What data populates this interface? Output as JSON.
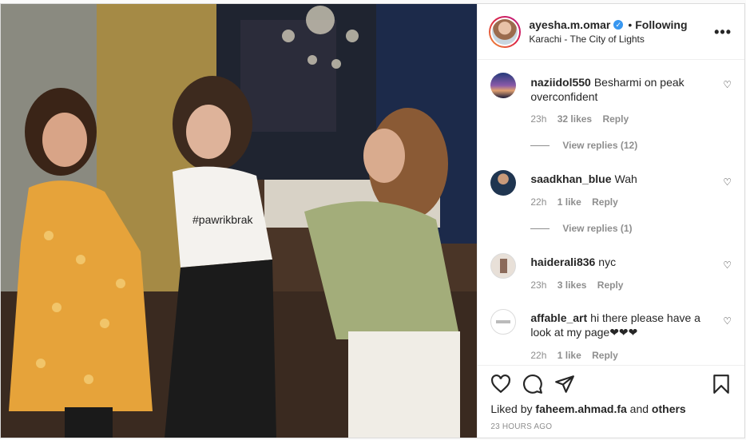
{
  "post": {
    "username": "ayesha.m.omar",
    "verified_icon": "verified-badge-icon",
    "separator": "•",
    "follow_status": "Following",
    "location": "Karachi - The City of Lights",
    "more_icon": "more-options-icon",
    "more_glyph": "•••",
    "video_overlay_text": "#pawrikbrak"
  },
  "comments": [
    {
      "user": "naziidol550",
      "text": "Besharmi on peak overconfident",
      "time": "23h",
      "likes": "32 likes",
      "reply": "Reply",
      "view_replies": "View replies (12)"
    },
    {
      "user": "saadkhan_blue",
      "text": "Wah",
      "time": "22h",
      "likes": "1 like",
      "reply": "Reply",
      "view_replies": "View replies (1)"
    },
    {
      "user": "haiderali836",
      "text": "nyc",
      "time": "23h",
      "likes": "3 likes",
      "reply": "Reply"
    },
    {
      "user": "affable_art",
      "text": "hi there please have a look at my page❤❤❤",
      "time": "22h",
      "likes": "1 like",
      "reply": "Reply"
    }
  ],
  "actions": {
    "like_icon": "heart-icon",
    "comment_icon": "comment-icon",
    "share_icon": "share-icon",
    "save_icon": "bookmark-icon",
    "liked_by_prefix": "Liked by",
    "liked_by_user": "faheem.ahmad.fa",
    "liked_by_and": "and",
    "liked_by_others": "others",
    "timestamp": "23 HOURS AGO"
  },
  "colors": {
    "accent_blue": "#3897f0",
    "text": "#262626",
    "muted": "#8e8e8e",
    "border": "#dbdbdb"
  }
}
